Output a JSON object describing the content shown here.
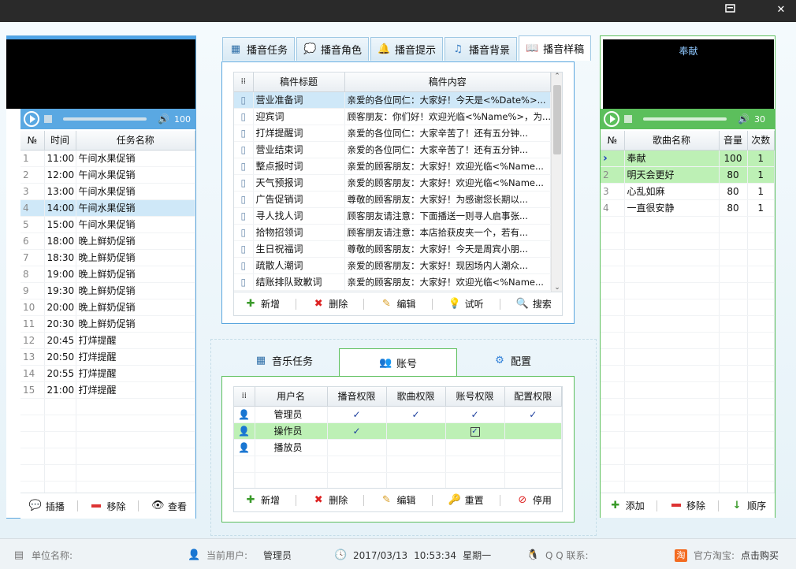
{
  "titlebar": {
    "restore_icon": "restore-icon",
    "close_icon": "close-icon"
  },
  "left": {
    "volume": "100",
    "columns": [
      "№",
      "时间",
      "任务名称"
    ],
    "rows": [
      {
        "n": "1",
        "time": "11:00",
        "name": "午间水果促销"
      },
      {
        "n": "2",
        "time": "12:00",
        "name": "午间水果促销"
      },
      {
        "n": "3",
        "time": "13:00",
        "name": "午间水果促销"
      },
      {
        "n": "4",
        "time": "14:00",
        "name": "午间水果促销"
      },
      {
        "n": "5",
        "time": "15:00",
        "name": "午间水果促销"
      },
      {
        "n": "6",
        "time": "18:00",
        "name": "晚上鲜奶促销"
      },
      {
        "n": "7",
        "time": "18:30",
        "name": "晚上鲜奶促销"
      },
      {
        "n": "8",
        "time": "19:00",
        "name": "晚上鲜奶促销"
      },
      {
        "n": "9",
        "time": "19:30",
        "name": "晚上鲜奶促销"
      },
      {
        "n": "10",
        "time": "20:00",
        "name": "晚上鲜奶促销"
      },
      {
        "n": "11",
        "time": "20:30",
        "name": "晚上鲜奶促销"
      },
      {
        "n": "12",
        "time": "20:45",
        "name": "打烊提醒"
      },
      {
        "n": "13",
        "time": "20:50",
        "name": "打烊提醒"
      },
      {
        "n": "14",
        "time": "20:55",
        "name": "打烊提醒"
      },
      {
        "n": "15",
        "time": "21:00",
        "name": "打烊提醒"
      }
    ],
    "toolbar": {
      "insert": "插播",
      "remove": "移除",
      "view": "查看"
    }
  },
  "center": {
    "tabs": [
      "播音任务",
      "播音角色",
      "播音提示",
      "播音背景",
      "播音样稿"
    ],
    "columns": [
      "稿件标题",
      "稿件内容"
    ],
    "rows": [
      {
        "title": "营业准备词",
        "content": "亲爱的各位同仁：大家好！今天是<%Date%>..."
      },
      {
        "title": "迎宾词",
        "content": "顾客朋友：你们好！欢迎光临<%Name%>，为..."
      },
      {
        "title": "打烊提醒词",
        "content": "亲爱的各位同仁：大家辛苦了！还有五分钟..."
      },
      {
        "title": "营业结束词",
        "content": "亲爱的各位同仁：大家辛苦了！还有五分钟..."
      },
      {
        "title": "整点报时词",
        "content": "亲爱的顾客朋友：大家好！欢迎光临<%Name..."
      },
      {
        "title": "天气预报词",
        "content": "亲爱的顾客朋友：大家好！欢迎光临<%Name..."
      },
      {
        "title": "广告促销词",
        "content": "尊敬的顾客朋友：大家好！为感谢您长期以..."
      },
      {
        "title": "寻人找人词",
        "content": "顾客朋友请注意：下面播送一则寻人启事张..."
      },
      {
        "title": "拾物招领词",
        "content": "顾客朋友请注意：本店拾获皮夹一个，若有..."
      },
      {
        "title": "生日祝福词",
        "content": "尊敬的顾客朋友：大家好！今天是周宾小朋..."
      },
      {
        "title": "疏散人潮词",
        "content": "亲爱的顾客朋友：大家好！现因场内人潮众..."
      },
      {
        "title": "结账排队致歉词",
        "content": "亲爱的顾客朋友：大家好！欢迎光临<%Name..."
      }
    ],
    "toolbar": {
      "add": "新增",
      "delete": "删除",
      "edit": "编辑",
      "listen": "试听",
      "search": "搜索"
    },
    "tabs2": [
      "音乐任务",
      "账号",
      "配置"
    ],
    "acc_columns": [
      "用户名",
      "播音权限",
      "歌曲权限",
      "账号权限",
      "配置权限"
    ],
    "acc_rows": [
      {
        "name": "管理员",
        "p1": "✓",
        "p2": "✓",
        "p3": "✓",
        "p4": "✓"
      },
      {
        "name": "操作员",
        "p1": "✓",
        "p2": "",
        "p3": "✓",
        "p4": ""
      },
      {
        "name": "播放员",
        "p1": "",
        "p2": "",
        "p3": "",
        "p4": ""
      }
    ],
    "acc_toolbar": {
      "add": "新增",
      "delete": "删除",
      "edit": "编辑",
      "reset": "重置",
      "disable": "停用"
    }
  },
  "right": {
    "now_playing": "奉献",
    "volume": "30",
    "columns": [
      "№",
      "歌曲名称",
      "音量",
      "次数"
    ],
    "rows": [
      {
        "n": "",
        "name": "奉献",
        "vol": "100",
        "cnt": "1"
      },
      {
        "n": "2",
        "name": "明天会更好",
        "vol": "80",
        "cnt": "1"
      },
      {
        "n": "3",
        "name": "心乱如麻",
        "vol": "80",
        "cnt": "1"
      },
      {
        "n": "4",
        "name": "一直很安静",
        "vol": "80",
        "cnt": "1"
      }
    ],
    "toolbar": {
      "add": "添加",
      "remove": "移除",
      "order": "顺序"
    }
  },
  "status": {
    "unit_label": "单位名称:",
    "user_label": "当前用户:",
    "user": "管理员",
    "date": "2017/03/13",
    "time": "10:53:34",
    "weekday": "星期一",
    "qq_label": "Q Q 联系:",
    "taobao_label": "官方淘宝:",
    "buy": "点击购买"
  }
}
